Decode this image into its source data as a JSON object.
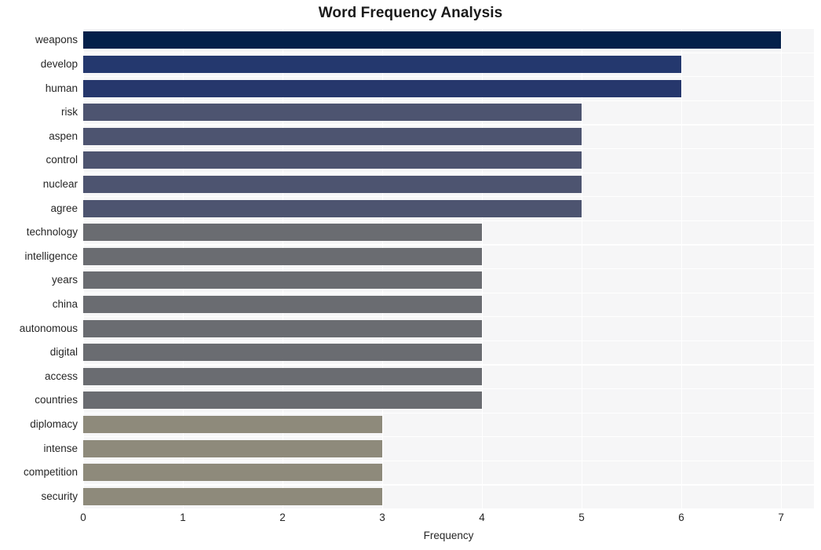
{
  "chart_data": {
    "type": "bar",
    "orientation": "horizontal",
    "title": "Word Frequency Analysis",
    "xlabel": "Frequency",
    "ylabel": "",
    "xlim": [
      0,
      7.33
    ],
    "xticks": [
      0,
      1,
      2,
      3,
      4,
      5,
      6,
      7
    ],
    "xtick_labels": [
      "0",
      "1",
      "2",
      "3",
      "4",
      "5",
      "6",
      "7"
    ],
    "grid": true,
    "legend": "none",
    "categories": [
      "weapons",
      "develop",
      "human",
      "risk",
      "aspen",
      "control",
      "nuclear",
      "agree",
      "technology",
      "intelligence",
      "years",
      "china",
      "autonomous",
      "digital",
      "access",
      "countries",
      "diplomacy",
      "intense",
      "competition",
      "security"
    ],
    "values": [
      7,
      6,
      6,
      5,
      5,
      5,
      5,
      5,
      4,
      4,
      4,
      4,
      4,
      4,
      4,
      4,
      3,
      3,
      3,
      3
    ],
    "bar_colors": [
      "#04204a",
      "#24386e",
      "#26376c",
      "#4d5470",
      "#4d5470",
      "#4d5470",
      "#4d5470",
      "#4d5470",
      "#6a6c71",
      "#6a6c71",
      "#6a6c71",
      "#6a6c71",
      "#6a6c71",
      "#6a6c71",
      "#6a6c71",
      "#6a6c71",
      "#8e8a7b",
      "#8e8a7b",
      "#8e8a7b",
      "#8e8a7b"
    ],
    "plot_background": "#f6f6f7",
    "grid_color": "#ffffff",
    "figure_background": "#ffffff"
  }
}
